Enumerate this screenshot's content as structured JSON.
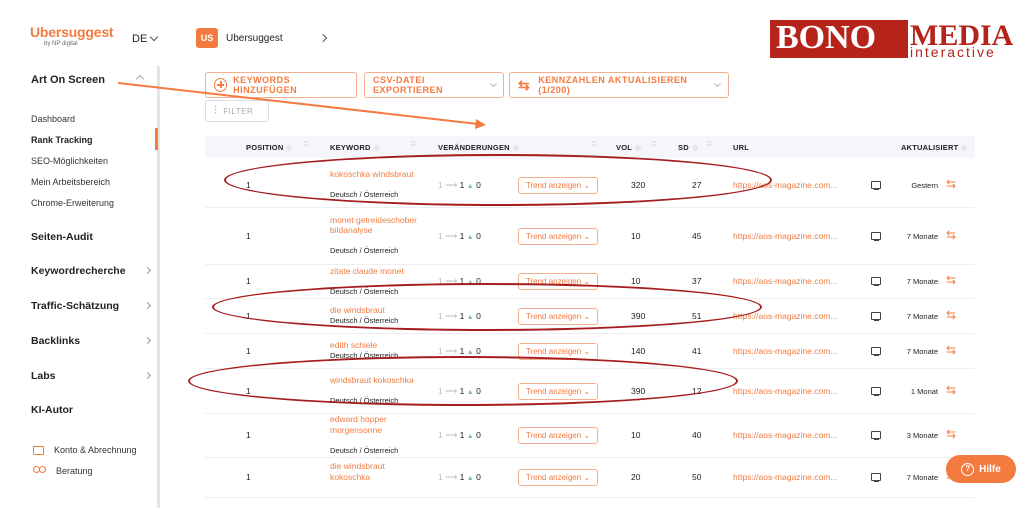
{
  "header": {
    "brand": "Ubersuggest",
    "brand_sub": "by NP digital",
    "language": "DE",
    "project_initials": "US",
    "project_name": "Ubersuggest"
  },
  "watermark": {
    "line1": "BONO",
    "line2": "MEDIA",
    "line3": "interactive"
  },
  "sidebar": {
    "project": "Art On Screen",
    "sub_items": [
      "Dashboard",
      "Rank Tracking",
      "SEO-Möglichkeiten",
      "Mein Arbeitsbereich",
      "Chrome-Erweiterung"
    ],
    "sections": [
      "Seiten-Audit",
      "Keywordrecherche",
      "Traffic-Schätzung",
      "Backlinks",
      "Labs",
      "KI-Autor"
    ],
    "account": [
      "Konto & Abrechnung",
      "Beratung"
    ]
  },
  "toolbar": {
    "add_keywords": "KEYWORDS HINZUFÜGEN",
    "export_csv": "CSV-DATEI EXPORTIEREN",
    "update_metrics": "KENNZAHLEN AKTUALISIEREN (1/200)",
    "filter": "FILTER"
  },
  "table": {
    "headers": {
      "position": "POSITION",
      "keyword": "KEYWORD",
      "changes": "VERÄNDERUNGEN",
      "vol": "VOL",
      "sd": "SD",
      "url": "URL",
      "updated": "AKTUALISIERT"
    },
    "trend_label": "Trend anzeigen",
    "rows": [
      {
        "position": "1",
        "keyword": "kokoschka windsbraut",
        "location": "Deutsch / Österreich",
        "from": "1",
        "to": "1",
        "delta": "0",
        "vol": "320",
        "sd": "27",
        "url": "https://aos-magazine.com...",
        "updated": "Gestern"
      },
      {
        "position": "1",
        "keyword": "monet getreideschober bildanalyse",
        "location": "Deutsch / Österreich",
        "from": "1",
        "to": "1",
        "delta": "0",
        "vol": "10",
        "sd": "45",
        "url": "https://aos-magazine.com...",
        "updated": "7 Monate"
      },
      {
        "position": "1",
        "keyword": "zitate claude monet",
        "location": "Deutsch / Österreich",
        "from": "1",
        "to": "1",
        "delta": "0",
        "vol": "10",
        "sd": "37",
        "url": "https://aos-magazine.com...",
        "updated": "7 Monate"
      },
      {
        "position": "1",
        "keyword": "die windsbraut",
        "location": "Deutsch / Österreich",
        "from": "1",
        "to": "1",
        "delta": "0",
        "vol": "390",
        "sd": "51",
        "url": "https://aos-magazine.com...",
        "updated": "7 Monate"
      },
      {
        "position": "1",
        "keyword": "edith schiele",
        "location": "Deutsch / Österreich",
        "from": "1",
        "to": "1",
        "delta": "0",
        "vol": "140",
        "sd": "41",
        "url": "https://aos-magazine.com...",
        "updated": "7 Monate"
      },
      {
        "position": "1",
        "keyword": "windsbraut kokoschka",
        "location": "Deutsch / Österreich",
        "from": "1",
        "to": "1",
        "delta": "0",
        "vol": "390",
        "sd": "12",
        "url": "https://aos-magazine.com...",
        "updated": "1 Monat"
      },
      {
        "position": "1",
        "keyword": "edward hopper morgensonne",
        "location": "Deutsch / Österreich",
        "from": "1",
        "to": "1",
        "delta": "0",
        "vol": "10",
        "sd": "40",
        "url": "https://aos-magazine.com...",
        "updated": "3 Monate"
      },
      {
        "position": "1",
        "keyword": "die windsbraut kokoschka",
        "location": "",
        "from": "1",
        "to": "1",
        "delta": "0",
        "vol": "20",
        "sd": "50",
        "url": "https://aos-magazine.com...",
        "updated": "7 Monate"
      }
    ]
  },
  "help": "Hilfe",
  "colors": {
    "accent": "#f47b3f",
    "annotation": "#a51d1d",
    "watermark": "#b5231b"
  }
}
